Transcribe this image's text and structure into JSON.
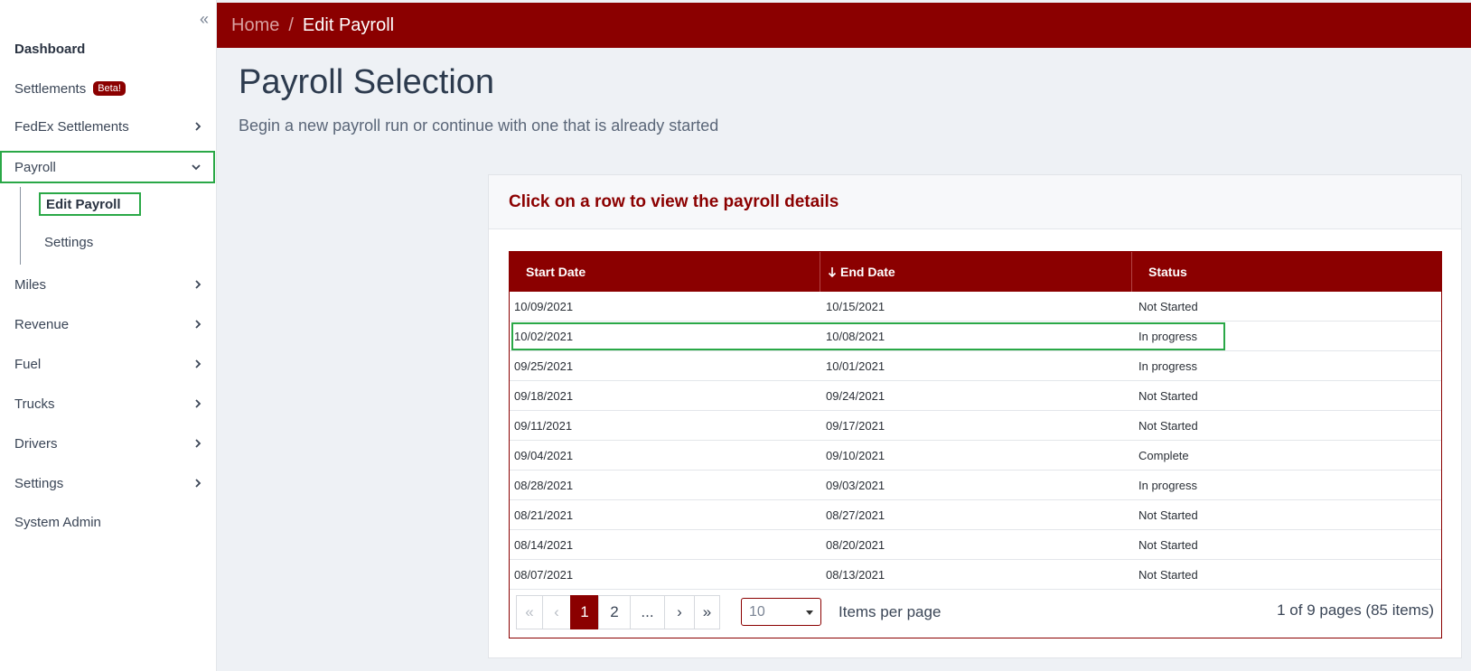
{
  "sidebar": {
    "collapse_glyph": "«",
    "items": [
      {
        "label": "Dashboard"
      },
      {
        "label": "Settlements",
        "badge": "Beta!"
      },
      {
        "label": "FedEx Settlements"
      },
      {
        "label": "Payroll"
      },
      {
        "label": "Miles"
      },
      {
        "label": "Revenue"
      },
      {
        "label": "Fuel"
      },
      {
        "label": "Trucks"
      },
      {
        "label": "Drivers"
      },
      {
        "label": "Settings"
      },
      {
        "label": "System Admin"
      }
    ],
    "payroll_sub": [
      {
        "label": "Edit Payroll"
      },
      {
        "label": "Settings"
      }
    ]
  },
  "breadcrumb": {
    "home": "Home",
    "separator": "/",
    "current": "Edit Payroll"
  },
  "page": {
    "title": "Payroll Selection",
    "subtitle": "Begin a new payroll run or continue with one that is already started"
  },
  "card": {
    "header": "Click on a row to view the payroll details"
  },
  "grid": {
    "columns": [
      "Start Date",
      "End Date",
      "Status"
    ],
    "rows": [
      [
        "10/09/2021",
        "10/15/2021",
        "Not Started"
      ],
      [
        "10/02/2021",
        "10/08/2021",
        "In progress"
      ],
      [
        "09/25/2021",
        "10/01/2021",
        "In progress"
      ],
      [
        "09/18/2021",
        "09/24/2021",
        "Not Started"
      ],
      [
        "09/11/2021",
        "09/17/2021",
        "Not Started"
      ],
      [
        "09/04/2021",
        "09/10/2021",
        "Complete"
      ],
      [
        "08/28/2021",
        "09/03/2021",
        "In progress"
      ],
      [
        "08/21/2021",
        "08/27/2021",
        "Not Started"
      ],
      [
        "08/14/2021",
        "08/20/2021",
        "Not Started"
      ],
      [
        "08/07/2021",
        "08/13/2021",
        "Not Started"
      ]
    ]
  },
  "pager": {
    "first": "«",
    "prev": "‹",
    "pages": [
      "1",
      "2",
      "..."
    ],
    "next": "›",
    "last": "»",
    "page_size": "10",
    "items_per_page_label": "Items per page",
    "info": "1 of 9 pages (85 items)"
  },
  "colors": {
    "accent": "#8b0000",
    "highlight": "#2aa847"
  }
}
